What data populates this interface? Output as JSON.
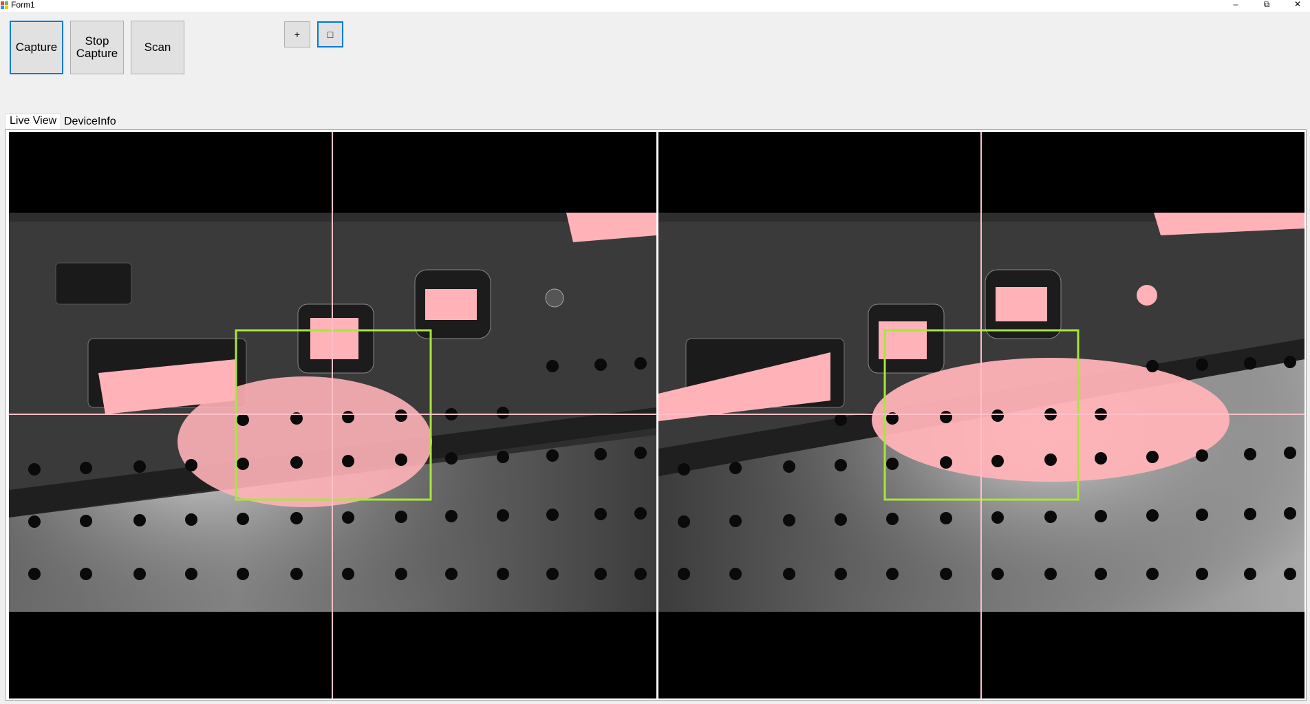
{
  "window": {
    "title": "Form1",
    "minimize": "–",
    "restore": "⧉",
    "close": "✕"
  },
  "toolbar": {
    "capture_label": "Capture",
    "stop_capture_label": "Stop Capture",
    "scan_label": "Scan",
    "plus_label": "+",
    "square_label": "□"
  },
  "tabs": [
    {
      "label": "Live View",
      "active": true
    },
    {
      "label": "DeviceInfo",
      "active": false
    }
  ],
  "colors": {
    "crosshair": "#ffc0c8",
    "roi": "#a8e63c",
    "overlay": "#ffb3b8",
    "focus": "#0078d7"
  }
}
